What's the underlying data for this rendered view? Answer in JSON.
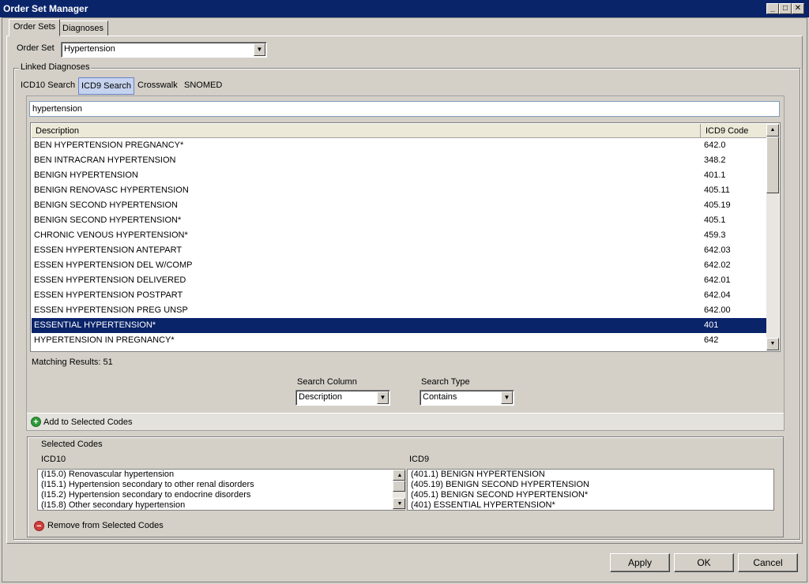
{
  "window": {
    "title": "Order Set Manager",
    "minimize": "_",
    "maximize": "□",
    "close": "✕"
  },
  "tabs": [
    {
      "label": "Order Sets"
    },
    {
      "label": "Diagnoses"
    }
  ],
  "order_set": {
    "label": "Order Set",
    "value": "Hypertension"
  },
  "linked_diagnoses": {
    "label": "Linked Diagnoses",
    "subtabs": [
      {
        "label": "ICD10 Search"
      },
      {
        "label": "ICD9 Search"
      },
      {
        "label": "Crosswalk"
      },
      {
        "label": "SNOMED"
      }
    ],
    "search_value": "hypertension",
    "grid": {
      "columns": {
        "description": "Description",
        "code": "ICD9 Code"
      },
      "rows": [
        {
          "desc": "BEN HYPERTENSION PREGNANCY*",
          "code": "642.0"
        },
        {
          "desc": "BEN INTRACRAN HYPERTENSION",
          "code": "348.2"
        },
        {
          "desc": "BENIGN HYPERTENSION",
          "code": "401.1"
        },
        {
          "desc": "BENIGN RENOVASC HYPERTENSION",
          "code": "405.11"
        },
        {
          "desc": "BENIGN SECOND HYPERTENSION",
          "code": "405.19"
        },
        {
          "desc": "BENIGN SECOND HYPERTENSION*",
          "code": "405.1"
        },
        {
          "desc": "CHRONIC VENOUS HYPERTENSION*",
          "code": "459.3"
        },
        {
          "desc": "ESSEN HYPERTENSION ANTEPART",
          "code": "642.03"
        },
        {
          "desc": "ESSEN HYPERTENSION DEL W/COMP",
          "code": "642.02"
        },
        {
          "desc": "ESSEN HYPERTENSION DELIVERED",
          "code": "642.01"
        },
        {
          "desc": "ESSEN HYPERTENSION POSTPART",
          "code": "642.04"
        },
        {
          "desc": "ESSEN HYPERTENSION PREG UNSP",
          "code": "642.00"
        },
        {
          "desc": "ESSENTIAL HYPERTENSION*",
          "code": "401"
        },
        {
          "desc": "HYPERTENSION IN PREGNANCY*",
          "code": "642"
        }
      ],
      "selected_index": 12
    },
    "matching_results": "Matching Results: 51",
    "search_column": {
      "label": "Search Column",
      "value": "Description"
    },
    "search_type": {
      "label": "Search Type",
      "value": "Contains"
    },
    "add_button": "Add to Selected Codes"
  },
  "selected_codes": {
    "label": "Selected Codes",
    "icd10_label": "ICD10",
    "icd9_label": "ICD9",
    "icd10_items": [
      "(I15.0) Renovascular hypertension",
      "(I15.1) Hypertension secondary to other renal disorders",
      "(I15.2) Hypertension secondary to endocrine disorders",
      "(I15.8) Other secondary hypertension"
    ],
    "icd9_items": [
      "(401.1) BENIGN HYPERTENSION",
      "(405.19) BENIGN SECOND HYPERTENSION",
      "(405.1) BENIGN SECOND HYPERTENSION*",
      "(401) ESSENTIAL HYPERTENSION*"
    ],
    "remove_button": "Remove from Selected Codes"
  },
  "footer": {
    "apply": "Apply",
    "ok": "OK",
    "cancel": "Cancel"
  },
  "colors": {
    "titlebar": "#0a246a",
    "selection": "#0a246a",
    "face": "#d4d0c8"
  },
  "icons": {
    "add": "plus-circle-icon",
    "remove": "minus-circle-icon"
  }
}
